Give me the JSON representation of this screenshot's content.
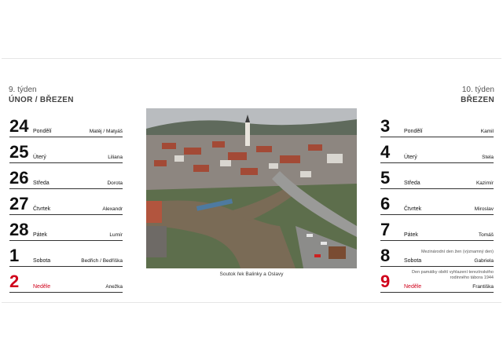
{
  "left": {
    "week": "9. týden",
    "month": "ÚNOR / BŘEZEN",
    "days": [
      {
        "num": "24",
        "weekday": "Pondělí",
        "names": "Matěj / Matyáš",
        "note": "",
        "red": false
      },
      {
        "num": "25",
        "weekday": "Úterý",
        "names": "Liliana",
        "note": "",
        "red": false
      },
      {
        "num": "26",
        "weekday": "Středa",
        "names": "Dorota",
        "note": "",
        "red": false
      },
      {
        "num": "27",
        "weekday": "Čtvrtek",
        "names": "Alexandr",
        "note": "",
        "red": false
      },
      {
        "num": "28",
        "weekday": "Pátek",
        "names": "Lumír",
        "note": "",
        "red": false
      },
      {
        "num": "1",
        "weekday": "Sobota",
        "names": "Bedřich / Bedřiška",
        "note": "",
        "red": false
      },
      {
        "num": "2",
        "weekday": "Neděle",
        "names": "Anežka",
        "note": "",
        "red": true
      }
    ]
  },
  "right": {
    "week": "10. týden",
    "month": "BŘEZEN",
    "days": [
      {
        "num": "3",
        "weekday": "Pondělí",
        "names": "Kamil",
        "note": "",
        "red": false
      },
      {
        "num": "4",
        "weekday": "Úterý",
        "names": "Stela",
        "note": "",
        "red": false
      },
      {
        "num": "5",
        "weekday": "Středa",
        "names": "Kazimír",
        "note": "",
        "red": false
      },
      {
        "num": "6",
        "weekday": "Čtvrtek",
        "names": "Miroslav",
        "note": "",
        "red": false
      },
      {
        "num": "7",
        "weekday": "Pátek",
        "names": "Tomáš",
        "note": "",
        "red": false
      },
      {
        "num": "8",
        "weekday": "Sobota",
        "names": "Gabriela",
        "note": "Mezinárodní den žen (významný den)",
        "red": false
      },
      {
        "num": "9",
        "weekday": "Neděle",
        "names": "Františka",
        "note": "Den památky obětí vyhlazení terezínského rodinného tábora 1944",
        "red": true
      }
    ]
  },
  "photo": {
    "caption": "Soutok řek Balinky a Oslavy"
  },
  "colors": {
    "sunday": "#d0021b",
    "rule": "#333333"
  }
}
